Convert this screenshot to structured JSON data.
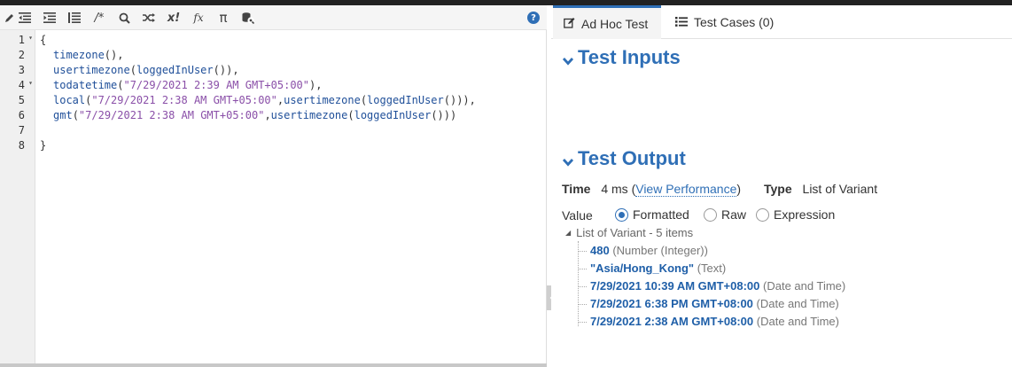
{
  "editor": {
    "toolbar": {
      "icons": [
        "pencil-icon",
        "outdent-icon",
        "indent-icon",
        "format-icon",
        "comment-icon",
        "search-icon",
        "shuffle-icon",
        "x-factorial-icon",
        "function-icon",
        "pi-icon",
        "database-search-icon"
      ],
      "comment_glyph": "/*",
      "x_glyph": "x!",
      "fx_glyph": "fx",
      "pi_glyph": "π",
      "help_glyph": "?"
    },
    "line_numbers": [
      "1",
      "2",
      "3",
      "4",
      "5",
      "6",
      "7",
      "8"
    ],
    "fold_glyph": "▾",
    "code": {
      "l1_brace": "{",
      "l2_fn": "timezone",
      "l2_rest": "(),",
      "l3_fn1": "usertimezone",
      "l3_p1": "(",
      "l3_fn2": "loggedInUser",
      "l3_p2": "()),",
      "l4_fn": "todatetime",
      "l4_p1": "(",
      "l4_str": "\"7/29/2021 2:39 AM GMT+05:00\"",
      "l4_p2": "),",
      "l5_fn": "local",
      "l5_p1": "(",
      "l5_str": "\"7/29/2021 2:38 AM GMT+05:00\"",
      "l5_p2": ",",
      "l5_fn2": "usertimezone",
      "l5_p3": "(",
      "l5_fn3": "loggedInUser",
      "l5_p4": "())),",
      "l6_fn": "gmt",
      "l6_p1": "(",
      "l6_str": "\"7/29/2021 2:38 AM GMT+05:00\"",
      "l6_p2": ",",
      "l6_fn2": "usertimezone",
      "l6_p3": "(",
      "l6_fn3": "loggedInUser",
      "l6_p4": "()))",
      "l8_brace": "}"
    }
  },
  "tabs": [
    {
      "label": "Ad Hoc Test",
      "icon": "edit-icon",
      "active": true
    },
    {
      "label": "Test Cases (0)",
      "icon": "list-icon",
      "active": false
    }
  ],
  "test_inputs": {
    "title": "Test Inputs"
  },
  "test_output": {
    "title": "Test Output",
    "time_label": "Time",
    "time_value": "4 ms",
    "view_perf_open": "(",
    "view_perf_link": "View Performance",
    "view_perf_close": ")",
    "type_label": "Type",
    "type_value": "List of Variant",
    "value_label": "Value",
    "radio_options": [
      "Formatted",
      "Raw",
      "Expression"
    ],
    "selected_option": "Formatted",
    "tree_root": "List of Variant - 5 items",
    "items": [
      {
        "value": "480",
        "type": "(Number (Integer))"
      },
      {
        "value": "\"Asia/Hong_Kong\"",
        "type": "(Text)"
      },
      {
        "value": "7/29/2021 10:39 AM GMT+08:00",
        "type": "(Date and Time)"
      },
      {
        "value": "7/29/2021 6:38 PM GMT+08:00",
        "type": "(Date and Time)"
      },
      {
        "value": "7/29/2021 2:38 AM GMT+08:00",
        "type": "(Date and Time)"
      }
    ]
  },
  "colors": {
    "accent": "#2f6fb6",
    "string": "#8a4fa8",
    "function": "#1f4f99"
  }
}
